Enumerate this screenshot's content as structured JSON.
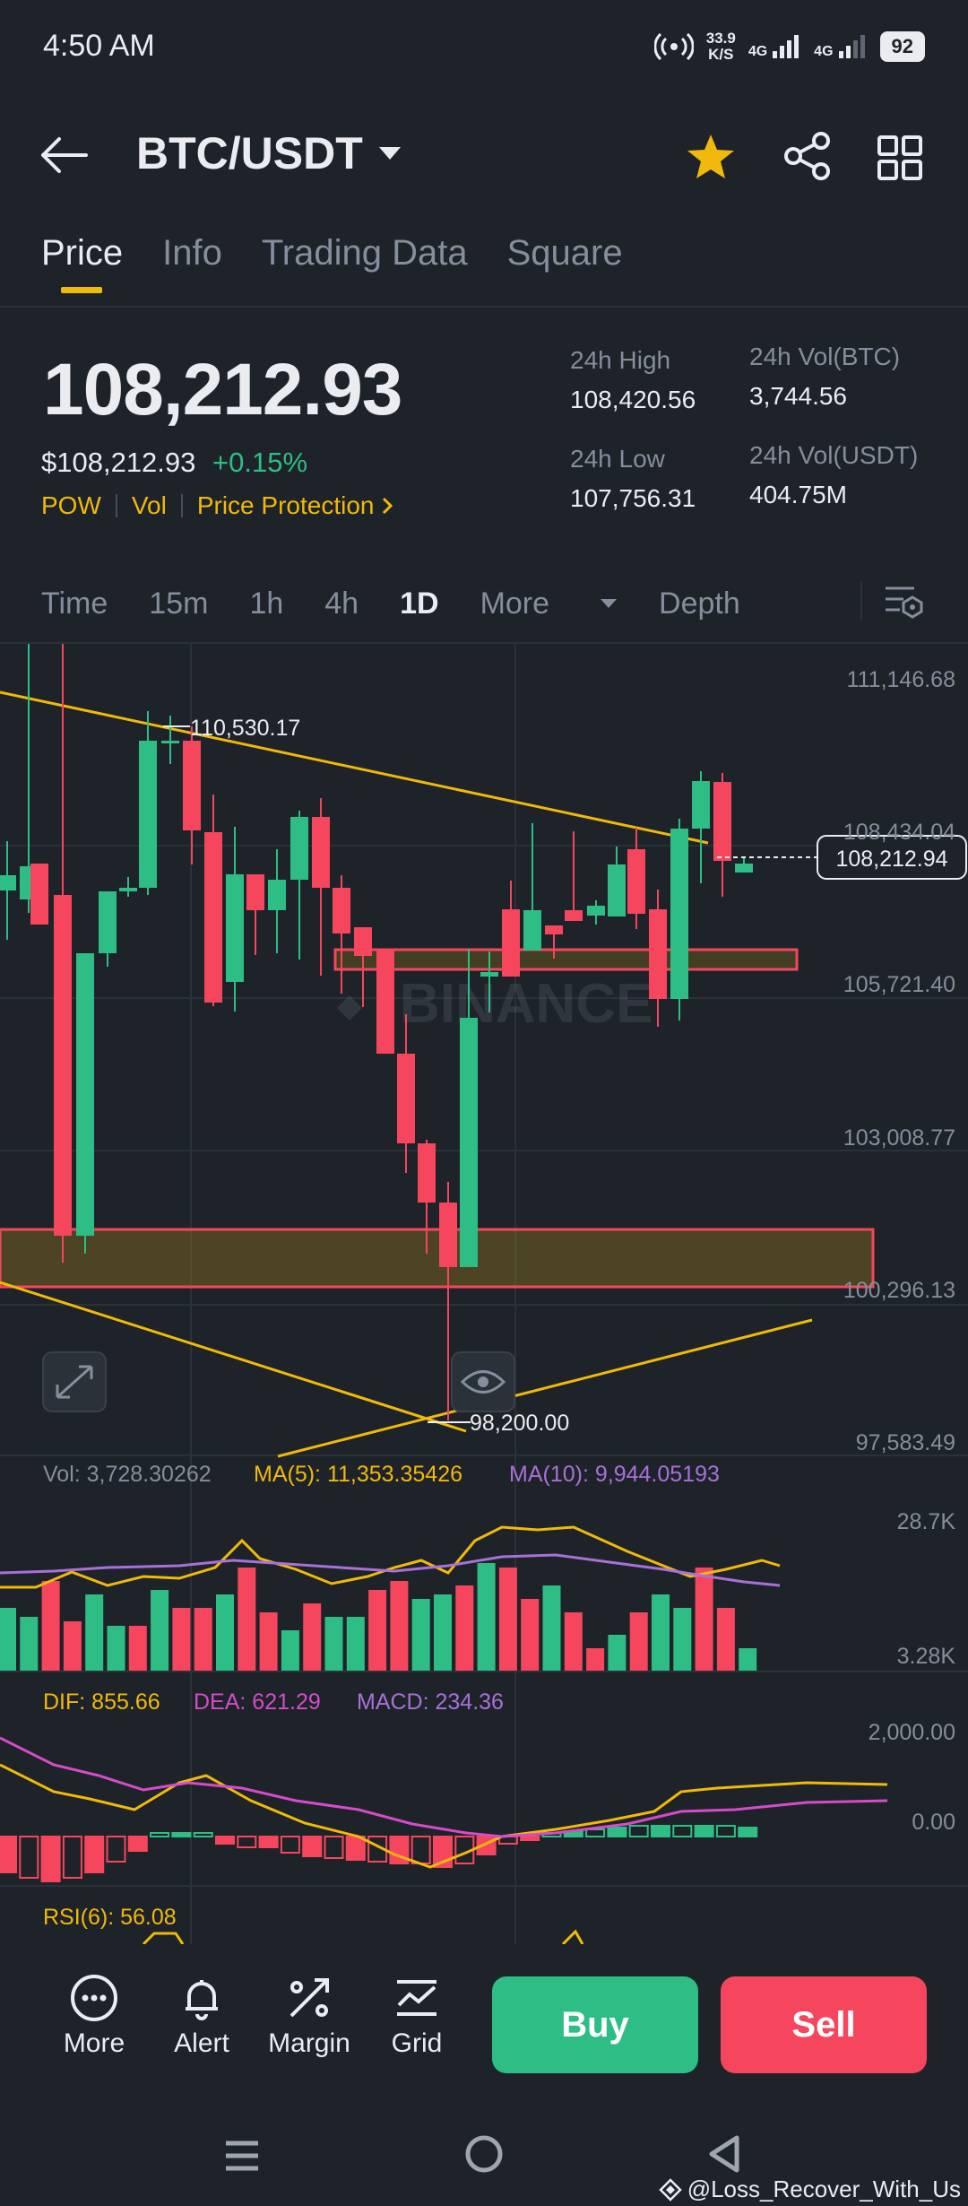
{
  "status_bar": {
    "time": "4:50 AM",
    "net_speed_value": "33.9",
    "net_speed_unit": "K/S",
    "network1": "4G",
    "network2": "4G",
    "battery": "92",
    "icons": [
      "hotspot-icon",
      "signal-icon",
      "signal-icon",
      "battery-icon"
    ]
  },
  "header": {
    "pair": "BTC/USDT",
    "icons": [
      "back-arrow-icon",
      "chevron-down-icon",
      "star-icon",
      "share-icon",
      "grid-icon"
    ],
    "favorite_color": "#f0b90b"
  },
  "tabs": [
    {
      "label": "Price",
      "active": true
    },
    {
      "label": "Info",
      "active": false
    },
    {
      "label": "Trading Data",
      "active": false
    },
    {
      "label": "Square",
      "active": false
    }
  ],
  "price": {
    "last": "108,212.93",
    "fiat": "$108,212.93",
    "change": "+0.15%",
    "tags": [
      "POW",
      "Vol",
      "Price Protection"
    ],
    "stats": {
      "high_label": "24h High",
      "high_value": "108,420.56",
      "low_label": "24h Low",
      "low_value": "107,756.31",
      "vol_btc_label": "24h Vol(BTC)",
      "vol_btc_value": "3,744.56",
      "vol_usdt_label": "24h Vol(USDT)",
      "vol_usdt_value": "404.75M"
    }
  },
  "intervals": {
    "items": [
      "Time",
      "15m",
      "1h",
      "4h",
      "1D",
      "More",
      "Depth"
    ],
    "active": "1D"
  },
  "chart_labels": {
    "price_axis": [
      "111,146.68",
      "108,434.04",
      "105,721.40",
      "103,008.77",
      "100,296.13",
      "97,583.49"
    ],
    "current_price_tag": "108,212.94",
    "high_marker": "110,530.17",
    "low_marker": "98,200.00",
    "watermark": "BINANCE",
    "vol_legend": "Vol: 3,728.30262",
    "ma5_legend": "MA(5): 11,353.35426",
    "ma10_legend": "MA(10): 9,944.05193",
    "vol_axis": [
      "28.7K",
      "3.28K"
    ],
    "dif_legend": "DIF: 855.66",
    "dea_legend": "DEA: 621.29",
    "macd_legend": "MACD: 234.36",
    "macd_axis": [
      "2,000.00",
      "0.00"
    ],
    "rsi_legend": "RSI(6): 56.08"
  },
  "colors": {
    "up": "#2ebd85",
    "down": "#f6465d",
    "accent": "#f0b90b",
    "ma10": "#a970d8",
    "dea": "#d64bcb"
  },
  "actions": {
    "more": "More",
    "alert": "Alert",
    "margin": "Margin",
    "grid": "Grid",
    "buy": "Buy",
    "sell": "Sell"
  },
  "watermark_text": "@Loss_Recover_With_Us"
}
